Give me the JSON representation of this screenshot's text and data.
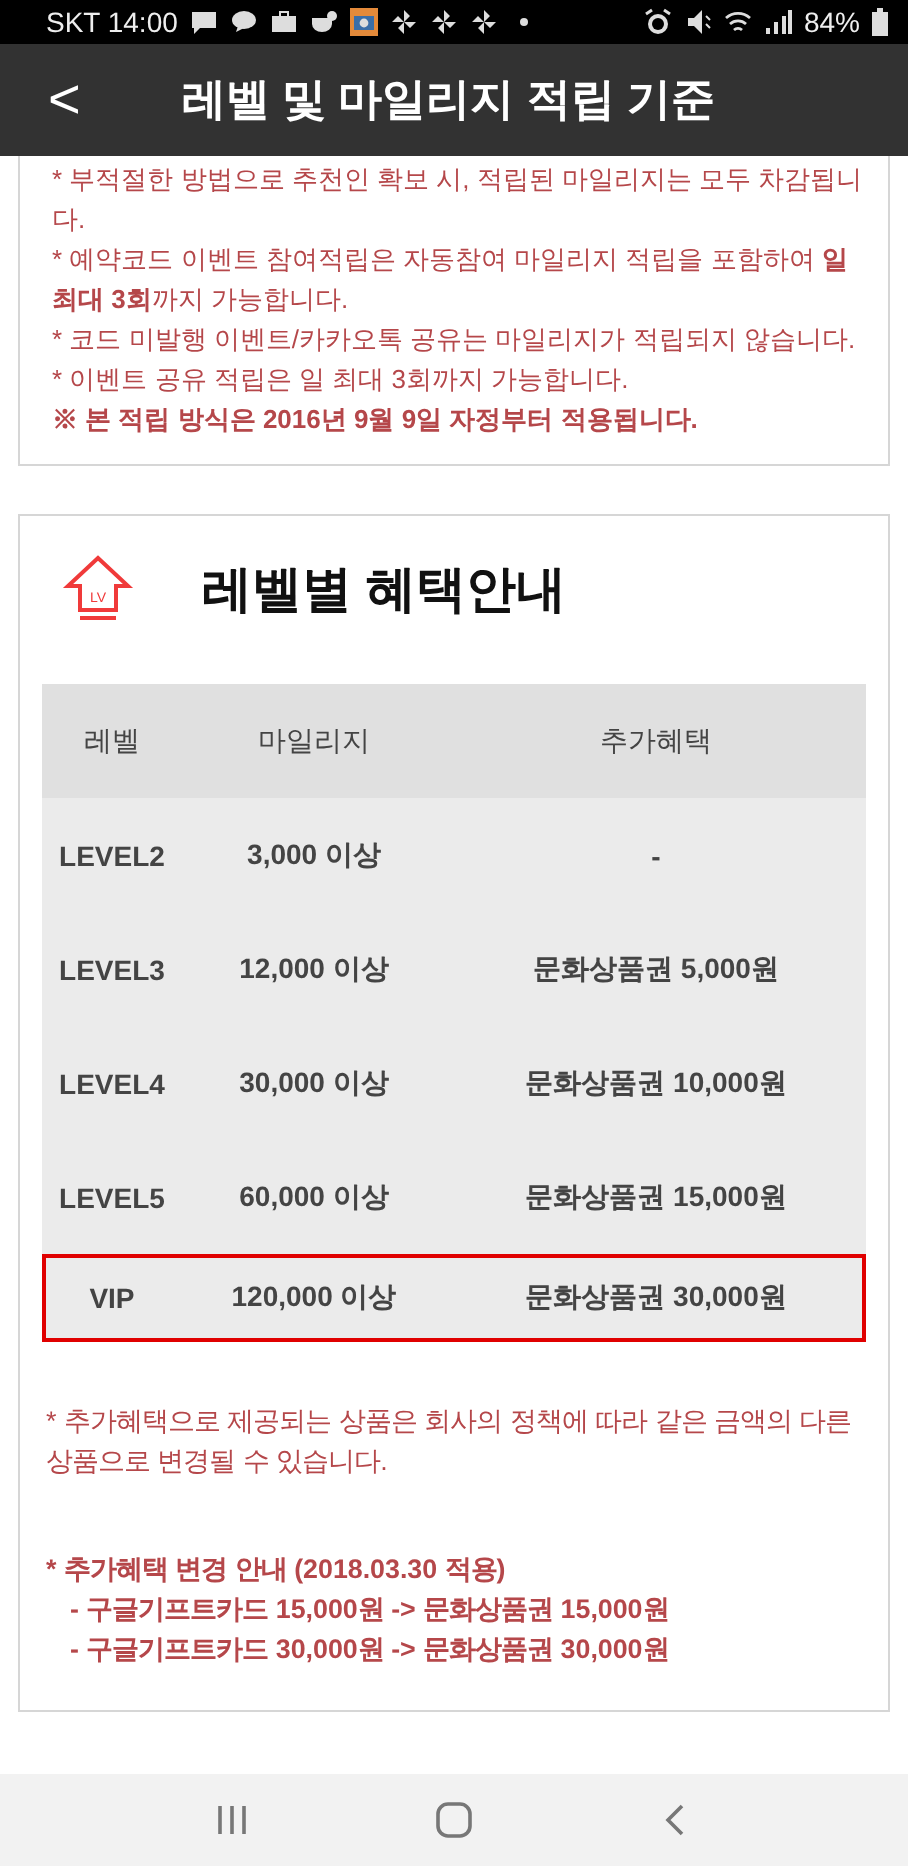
{
  "status_bar": {
    "carrier_time": "SKT 14:00",
    "battery": "84%"
  },
  "header": {
    "back": "<",
    "title": "레벨 및 마일리지 적립 기준"
  },
  "notes": [
    {
      "text": "* 부적절한 방법으로 추천인 확보 시, 적립된 마일리지는 모두 차감됩니다."
    },
    {
      "text": "* 예약코드 이벤트 참여적립은 자동참여 마일리지 적립을 포함하여 **일 최대 3회**까지 가능합니다."
    },
    {
      "text": "* 코드 미발행 이벤트/카카오톡 공유는 마일리지가 적립되지 않습니다."
    },
    {
      "text": "* 이벤트 공유 적립은 일 최대 3회까지 가능합니다."
    },
    {
      "text": "**※ 본 적립 방식은 2016년 9월 9일 자정부터 적용됩니다.**"
    }
  ],
  "benefits": {
    "icon_label": "LV",
    "title": "레벨별 혜택안내",
    "table": {
      "columns": [
        "레벨",
        "마일리지",
        "추가혜택"
      ],
      "rows": [
        {
          "cells": [
            "LEVEL2",
            "3,000 이상",
            "-"
          ],
          "highlighted": false
        },
        {
          "cells": [
            "LEVEL3",
            "12,000 이상",
            "문화상품권 5,000원"
          ],
          "highlighted": false
        },
        {
          "cells": [
            "LEVEL4",
            "30,000 이상",
            "문화상품권 10,000원"
          ],
          "highlighted": false
        },
        {
          "cells": [
            "LEVEL5",
            "60,000 이상",
            "문화상품권 15,000원"
          ],
          "highlighted": false
        },
        {
          "cells": [
            "VIP",
            "120,000 이상",
            "문화상품권 30,000원"
          ],
          "highlighted": true
        }
      ]
    },
    "footnote": "* 추가혜택으로 제공되는 상품은 회사의 정책에 따라 같은 금액의 다른 상품으로 변경될 수 있습니다.",
    "change_notice": {
      "heading": "* 추가혜택 변경 안내 (2018.03.30 적용)",
      "items": [
        "- 구글기프트카드 15,000원 -> 문화상품권 15,000원",
        "- 구글기프트카드 30,000원 -> 문화상품권 30,000원"
      ]
    }
  }
}
